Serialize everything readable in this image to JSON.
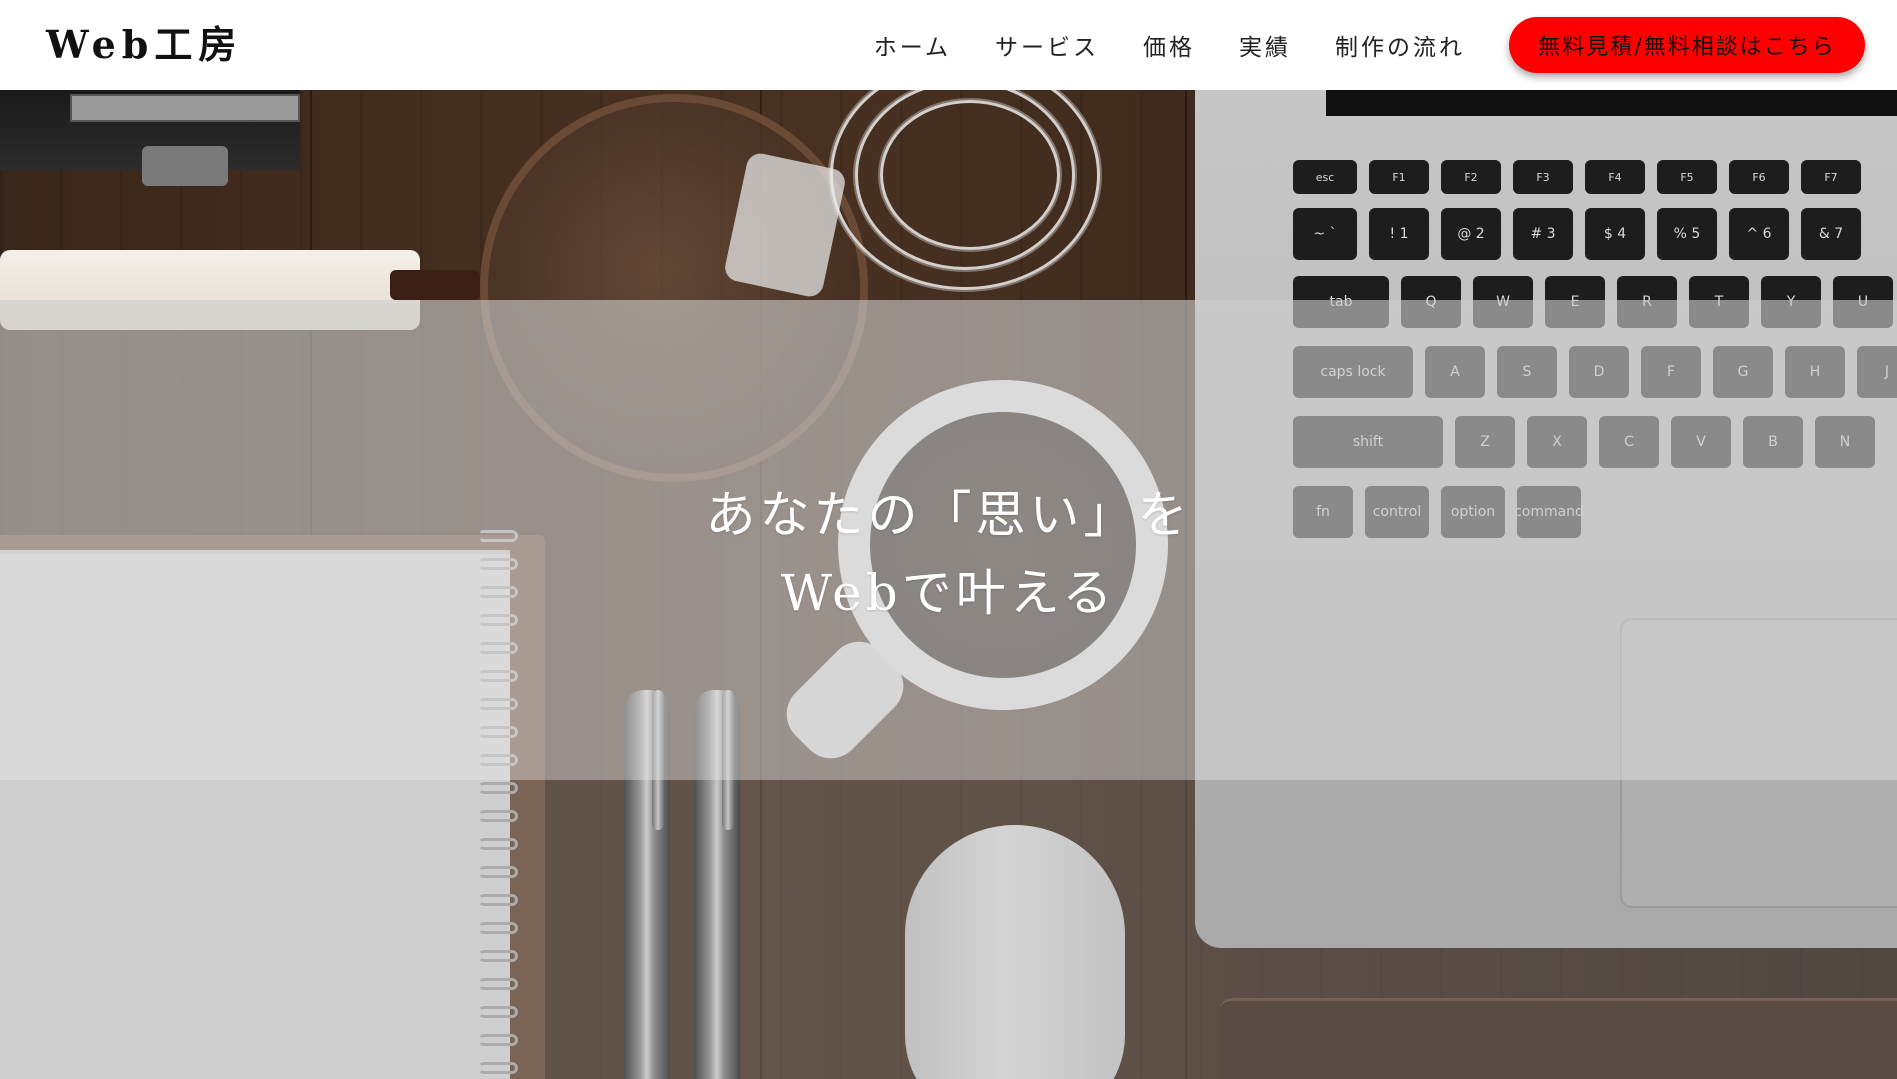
{
  "header": {
    "logo": "Web工房",
    "nav": [
      "ホーム",
      "サービス",
      "価格",
      "実績",
      "制作の流れ"
    ],
    "cta_label": "無料見積/無料相談はこちら",
    "cta_color": "#ff0000"
  },
  "hero": {
    "line1": "あなたの「思い」を",
    "line2": "Webで叶える"
  },
  "laptop_keys": {
    "fn_row": [
      "esc",
      "F1",
      "F2",
      "F3",
      "F4",
      "F5",
      "F6",
      "F7"
    ],
    "number_row": [
      "~ `",
      "! 1",
      "@ 2",
      "# 3",
      "$ 4",
      "% 5",
      "^ 6",
      "& 7"
    ],
    "row_q": [
      "tab",
      "Q",
      "W",
      "E",
      "R",
      "T",
      "Y",
      "U"
    ],
    "row_a": [
      "caps lock",
      "A",
      "S",
      "D",
      "F",
      "G",
      "H",
      "J"
    ],
    "row_z": [
      "shift",
      "Z",
      "X",
      "C",
      "V",
      "B",
      "N"
    ],
    "row_bottom": [
      "fn",
      "control",
      "option",
      "command"
    ]
  }
}
